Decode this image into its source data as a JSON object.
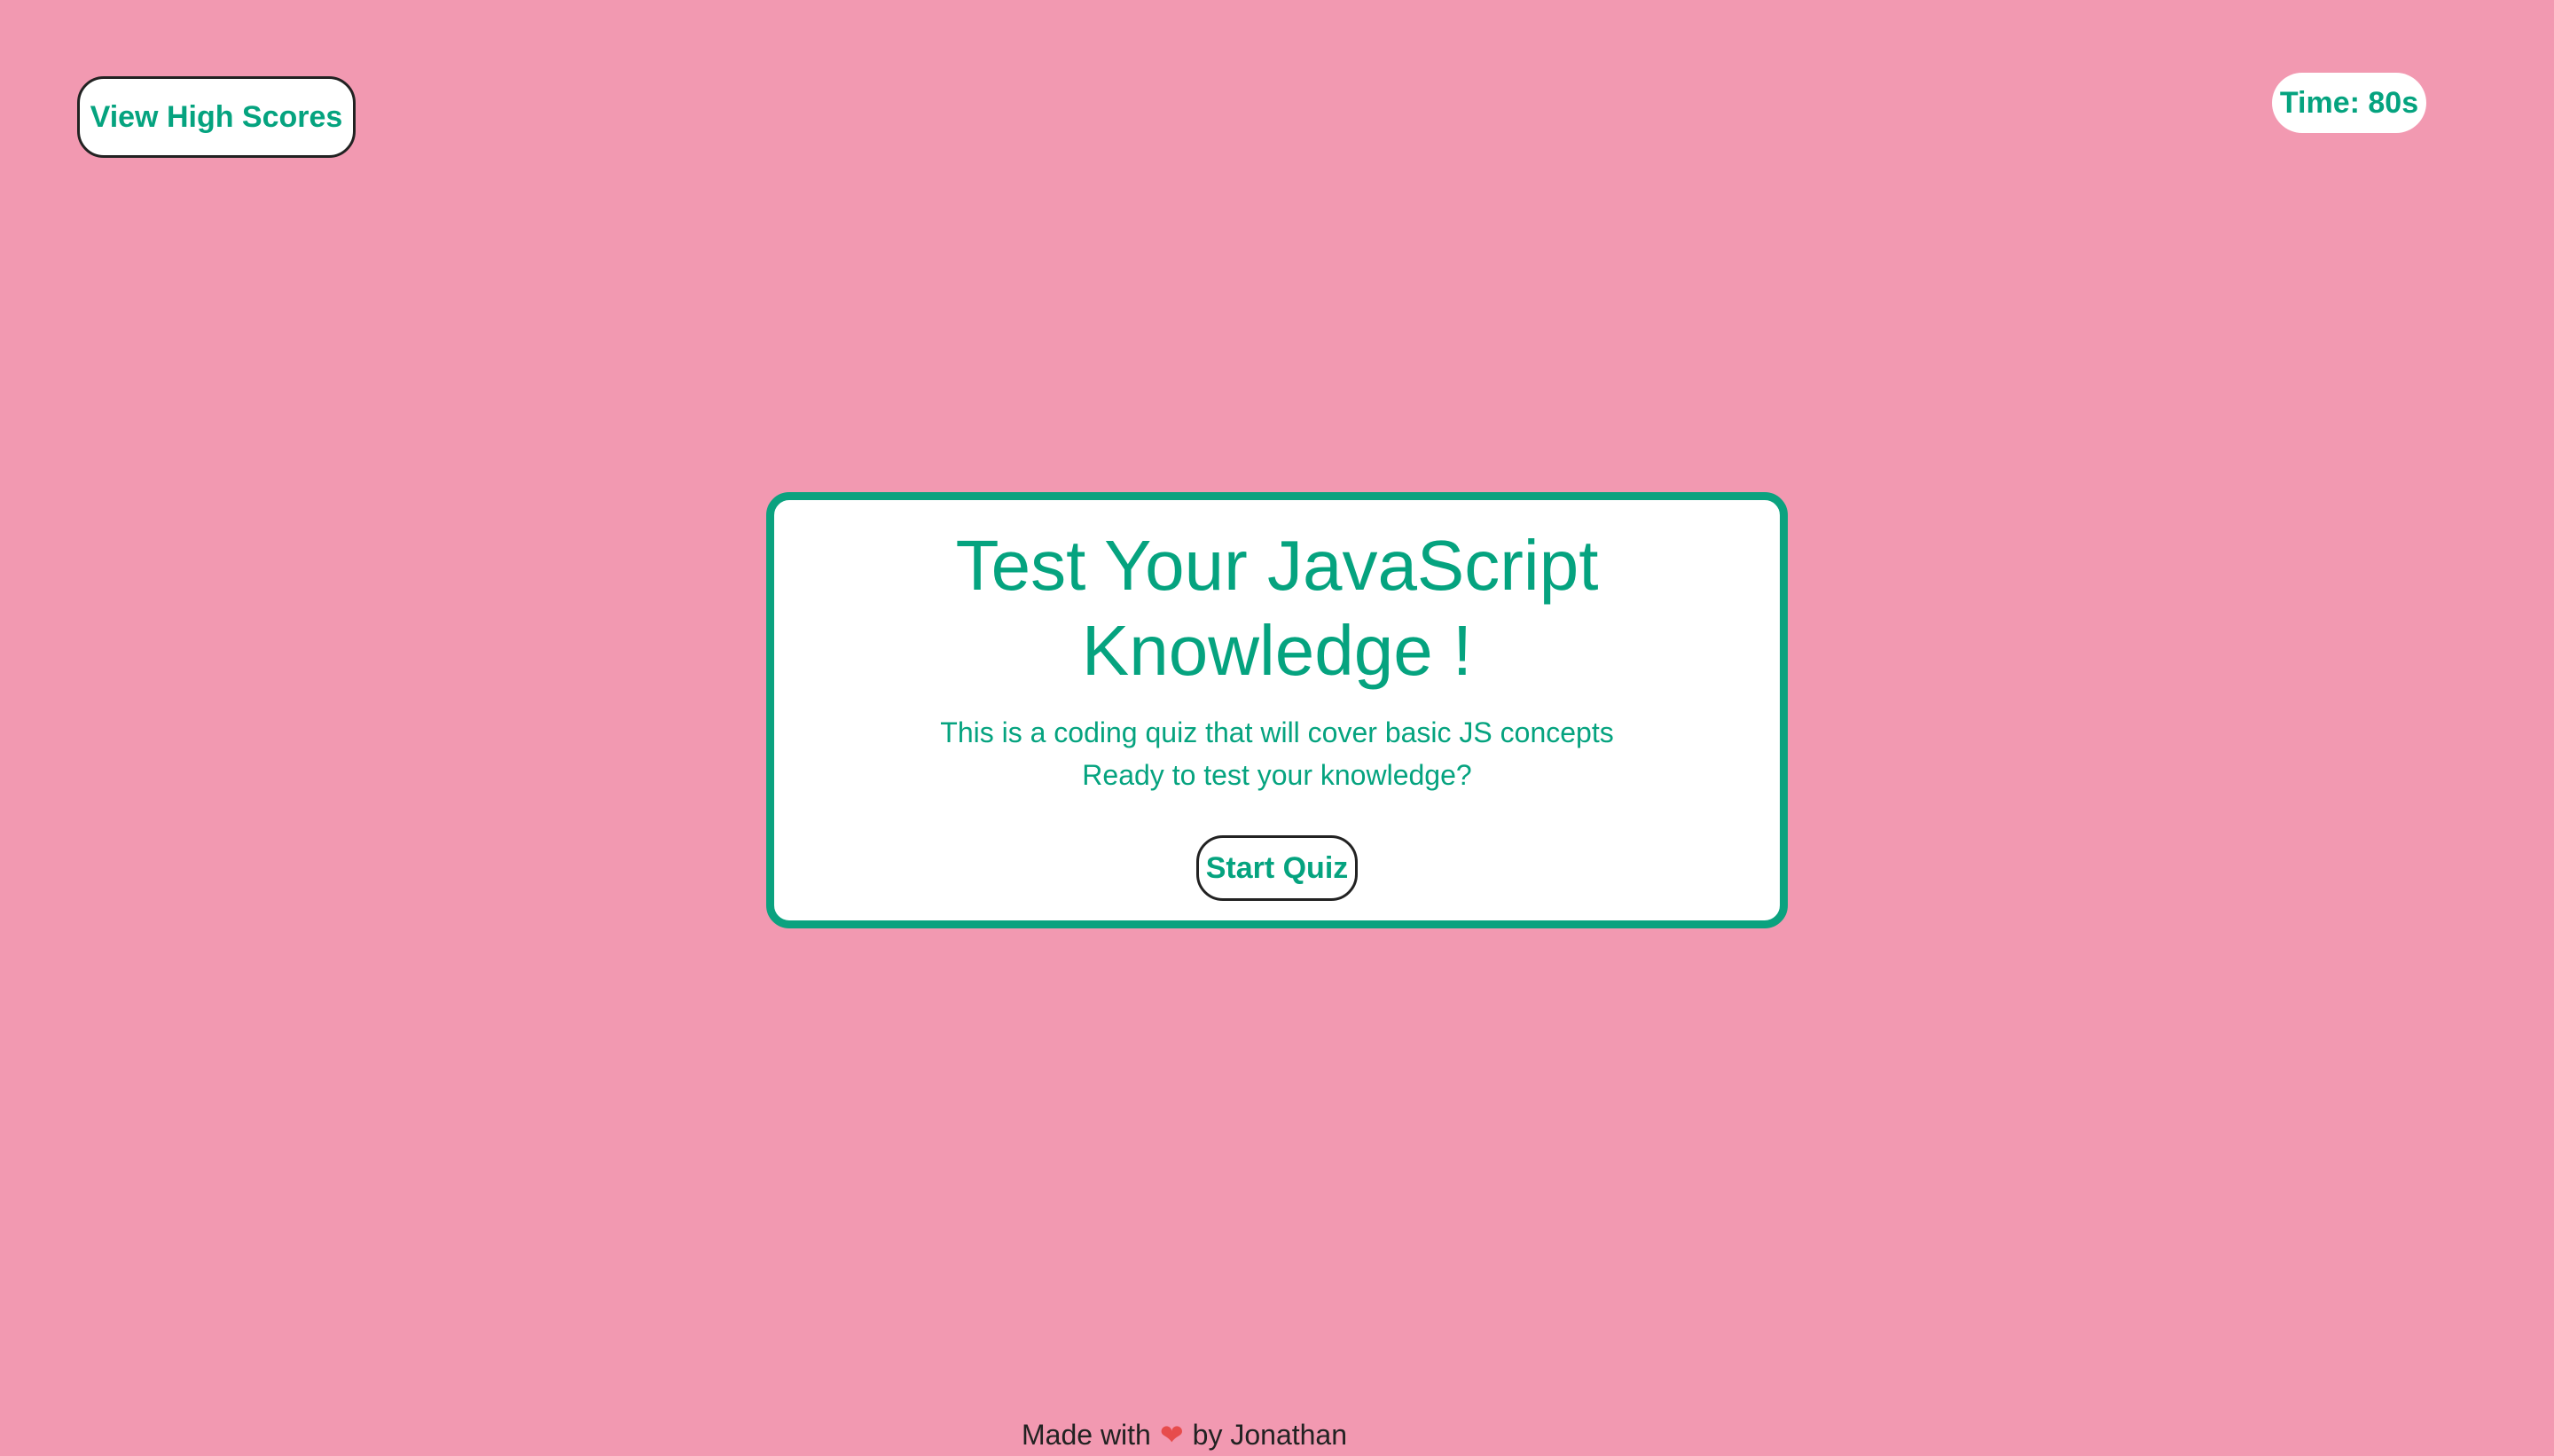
{
  "header": {
    "high_scores_label": "View High Scores",
    "timer_text": "Time: 80s"
  },
  "quiz": {
    "title": "Test Your JavaScript Knowledge !",
    "description_line1": "This is a coding quiz that will cover basic JS concepts",
    "description_line2": "Ready to test your knowledge?",
    "start_label": "Start Quiz"
  },
  "footer": {
    "prefix": "Made with",
    "heart_icon": "heart-icon",
    "suffix": "by Jonathan"
  },
  "colors": {
    "background": "#f299b1",
    "accent": "#05a37f",
    "border": "#0ba27f",
    "heart": "#e74c4c"
  }
}
